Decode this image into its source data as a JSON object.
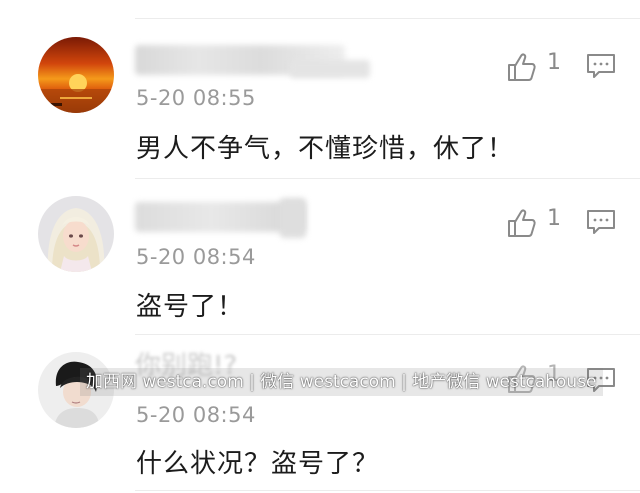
{
  "comments": [
    {
      "timestamp": "5-20 08:55",
      "text": "男人不争气，不懂珍惜，休了！",
      "likes": "1",
      "avatar": "sunset-avatar"
    },
    {
      "timestamp": "5-20 08:54",
      "text": "盗号了！",
      "likes": "1",
      "avatar": "girl-avatar"
    },
    {
      "timestamp": "5-20 08:54",
      "text": "什么状况？盗号了？",
      "likes": "1",
      "avatar": "boy-avatar"
    }
  ],
  "watermark": "加西网 westca.com | 微信 westcacom | 地产微信 westcahouse",
  "icons": {
    "like": "thumbs-up-icon",
    "reply": "comment-icon"
  },
  "colors": {
    "text": "#1c1c1c",
    "meta": "#9a9a9a",
    "icon": "#888888"
  }
}
